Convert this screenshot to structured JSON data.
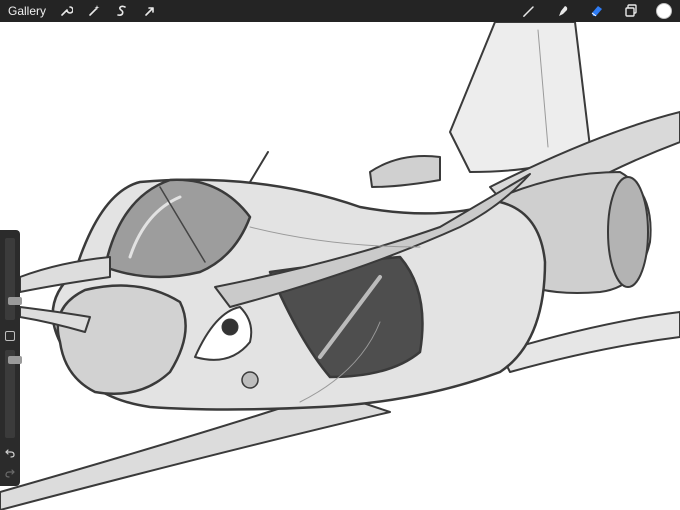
{
  "topbar": {
    "gallery_label": "Gallery",
    "left_tools": [
      "wrench-icon",
      "magic-wand-icon",
      "selection-icon",
      "transform-arrow-icon"
    ],
    "right_tools": [
      "brush-icon",
      "smudge-icon",
      "eraser-icon",
      "layers-icon"
    ],
    "active_tool": "eraser-icon",
    "active_color": "#ffffff",
    "accent_color": "#2f7df6"
  },
  "sidebar": {
    "size_slider_value": 0.2,
    "opacity_slider_value": 0.08,
    "modify_button": "square-icon",
    "undo": "undo-icon",
    "redo": "redo-icon"
  }
}
